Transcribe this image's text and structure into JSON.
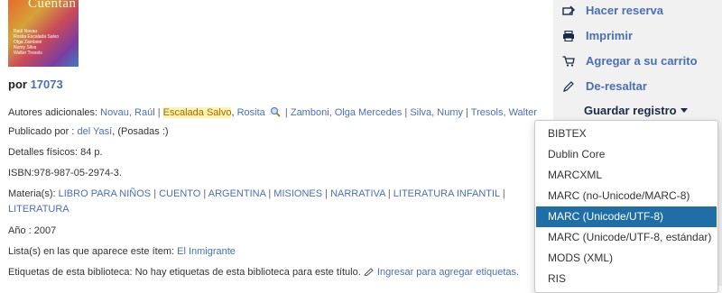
{
  "cover": {
    "title": "Cuentan",
    "authors": [
      "Raúl Novau",
      "Rosita Escalada Salvo",
      "Olga Zamboni",
      "Numy Silva",
      "Walter Tresols"
    ]
  },
  "por": {
    "label": "por",
    "author": "17073"
  },
  "autores": {
    "label": "Autores adicionales:",
    "names": [
      "Novau, Raúl",
      "Escalada Salvo",
      "Rosita",
      "Zamboni, Olga Mercedes",
      "Silva, Numy",
      "Tresols, Walter"
    ]
  },
  "publicado": {
    "label": "Publicado por :",
    "publisher": "del Yasí",
    "place": "(Posadas :)"
  },
  "detalles": {
    "label": "Detalles físicos:",
    "value": "84 p."
  },
  "isbn": {
    "label": "ISBN:",
    "value": "978-987-05-2974-3."
  },
  "materias": {
    "label": "Materia(s):",
    "items": [
      "LIBRO PARA NIÑOS",
      "CUENTO",
      "ARGENTINA",
      "MISIONES",
      "NARRATIVA",
      "LITERATURA INFANTIL",
      "LITERATURA"
    ]
  },
  "anio": {
    "label": "Año :",
    "value": "2007"
  },
  "listas": {
    "label": "Lista(s) en las que aparece este ítem:",
    "value": "El Inmigrante"
  },
  "etiquetas": {
    "label": "Etiquetas de esta biblioteca:",
    "value": "No hay etiquetas de esta biblioteca para este título.",
    "link": "Ingresar para agregar etiquetas."
  },
  "sidebar": {
    "actions": [
      "Hacer reserva",
      "Imprimir",
      "Agregar a su carrito",
      "De-resaltar"
    ],
    "guardar": "Guardar registro"
  },
  "dropdown": {
    "items": [
      "BIBTEX",
      "Dublin Core",
      "MARCXML",
      "MARC (no-Unicode/MARC-8)",
      "MARC (Unicode/UTF-8)",
      "MARC (Unicode/UTF-8, estándar)",
      "MODS (XML)",
      "RIS"
    ],
    "selected": "MARC (Unicode/UTF-8)"
  }
}
